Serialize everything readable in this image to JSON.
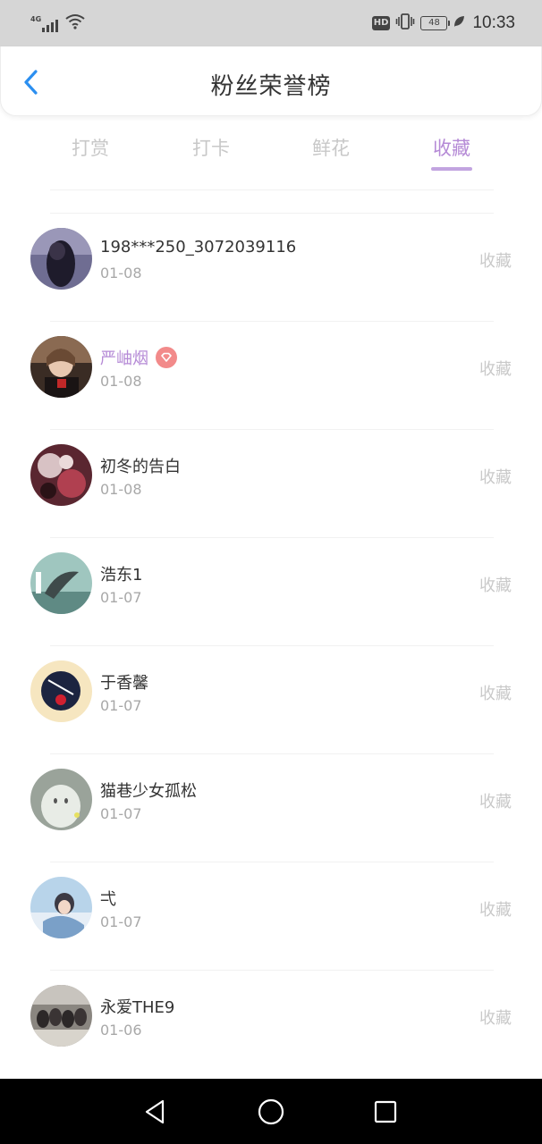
{
  "status_bar": {
    "network": "4G",
    "hd": "HD",
    "battery": "48",
    "time": "10:33"
  },
  "header": {
    "title": "粉丝荣誉榜"
  },
  "tabs": [
    {
      "label": "打赏",
      "active": false
    },
    {
      "label": "打卡",
      "active": false
    },
    {
      "label": "鲜花",
      "active": false
    },
    {
      "label": "收藏",
      "active": true
    }
  ],
  "list": [
    {
      "name": "198***250_3072039116",
      "date": "01-08",
      "action": "收藏",
      "vip": false
    },
    {
      "name": "严岫烟",
      "date": "01-08",
      "action": "收藏",
      "vip": true
    },
    {
      "name": "初冬的告白",
      "date": "01-08",
      "action": "收藏",
      "vip": false
    },
    {
      "name": "浩东1",
      "date": "01-07",
      "action": "收藏",
      "vip": false
    },
    {
      "name": "于香馨",
      "date": "01-07",
      "action": "收藏",
      "vip": false
    },
    {
      "name": "猫巷少女孤松",
      "date": "01-07",
      "action": "收藏",
      "vip": false
    },
    {
      "name": "弌",
      "date": "01-07",
      "action": "收藏",
      "vip": false
    },
    {
      "name": "永爱THE9",
      "date": "01-06",
      "action": "收藏",
      "vip": false
    }
  ],
  "colors": {
    "accent": "#b58ad6",
    "tab_inactive": "#c8c8c8",
    "back_arrow": "#2b8ff0",
    "badge": "#f28a8a"
  },
  "icons": {
    "back": "chevron-left-icon",
    "badge": "diamond-badge-icon",
    "nav": [
      "back-triangle-icon",
      "home-circle-icon",
      "recents-square-icon"
    ]
  }
}
